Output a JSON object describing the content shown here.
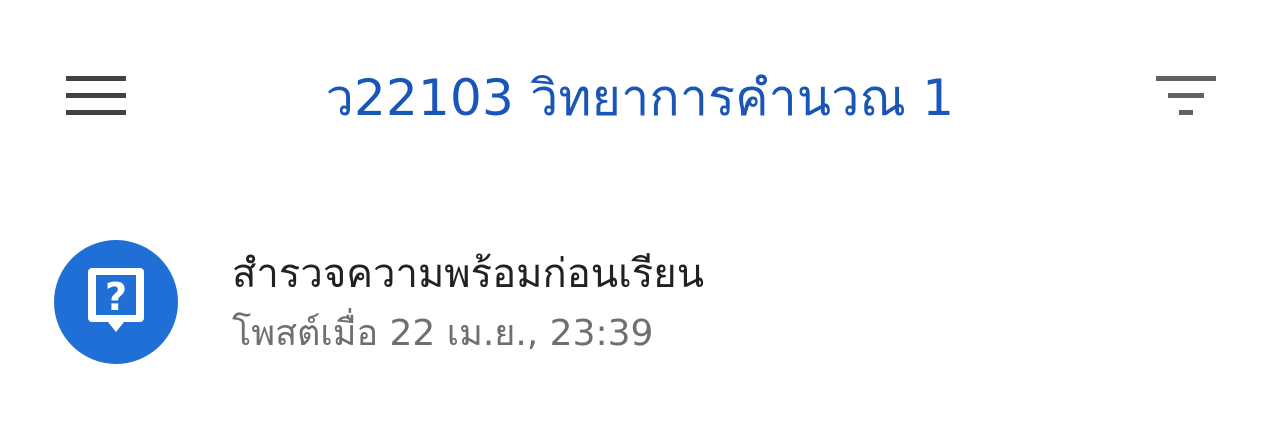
{
  "header": {
    "title": "ว22103 วิทยาการคำนวณ 1",
    "menu_icon": "hamburger-menu-icon",
    "filter_icon": "filter-icon",
    "title_color": "#1a56b8"
  },
  "stream": {
    "items": [
      {
        "type_icon": "question-icon",
        "icon_color": "#1f6fd6",
        "title": "สำรวจความพร้อมก่อนเรียน",
        "posted_prefix": "โพสต์เมื่อ",
        "posted_date": "22 เม.ย., 23:39"
      }
    ]
  }
}
